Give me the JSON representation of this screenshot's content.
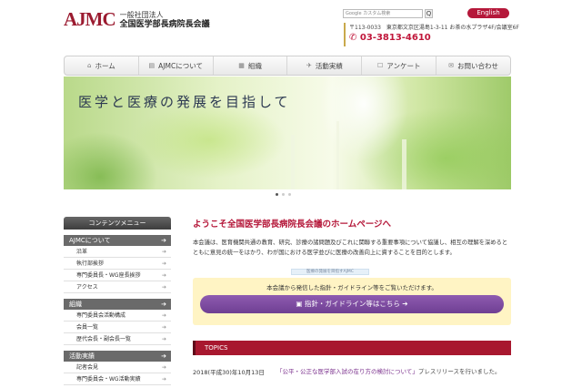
{
  "header": {
    "logo_mark": "AJMC",
    "logo_small": "一般社団法人",
    "logo_name": "全国医学部長病院長会議",
    "search_placeholder": "Google カスタム検索",
    "search_button": "Q",
    "english_button": "English",
    "address": "〒113-0033　東京都文京区湯島1-3-11 お茶の水プラザ4F/会議室6F",
    "phone": "03-3813-4610"
  },
  "nav": {
    "items": [
      {
        "icon": "⌂",
        "label": "ホーム"
      },
      {
        "icon": "▤",
        "label": "AJMCについて"
      },
      {
        "icon": "▦",
        "label": "組織"
      },
      {
        "icon": "✈",
        "label": "活動実績"
      },
      {
        "icon": "☐",
        "label": "アンケート"
      },
      {
        "icon": "✉",
        "label": "お問い合わせ"
      }
    ]
  },
  "hero": {
    "title": "医学と医療の発展を目指して"
  },
  "sidebar": {
    "title": "コンテンツメニュー",
    "sections": [
      {
        "head": "AJMCについて",
        "items": [
          "沿革",
          "執行部挨拶",
          "専門委員長・WG座長挨拶",
          "アクセス"
        ]
      },
      {
        "head": "組織",
        "items": [
          "専門委員会活動構成",
          "会員一覧",
          "歴代会長・副会長一覧"
        ]
      },
      {
        "head": "活動実績",
        "items": [
          "記者会見",
          "専門委員会・WG活動実績"
        ]
      }
    ]
  },
  "main": {
    "welcome": "ようこそ全国医学部長病院長会議のホームページへ",
    "intro": "本会議は、医育機関共通の教育、研究、診療の諸問題及びこれに関聯する重要事項について協議し、相互の理解を深めるとともに意見の統一をはかり、わが国における医学並びに医療の改善向上に資することを目的とします。",
    "tooltip": "医療の発展を目指すAJMC",
    "notice_text": "本会議から発信した指針・ガイドライン等をご覧いただけます。",
    "guide_button": "指針・ガイドライン等はこちら",
    "topics_title": "TOPICS",
    "topics": [
      {
        "date": "2018(平成30)年10月13日",
        "link": "「公平・公正な医学部入試の在り方の検討について」",
        "text": "プレスリリースを行いました。"
      }
    ]
  },
  "colors": {
    "brand": "#b5183a",
    "topics_bar": "#a8182f",
    "guide_button": "#7a4aa0",
    "notice_bg": "#fff4c4",
    "phone": "#c0163a"
  }
}
